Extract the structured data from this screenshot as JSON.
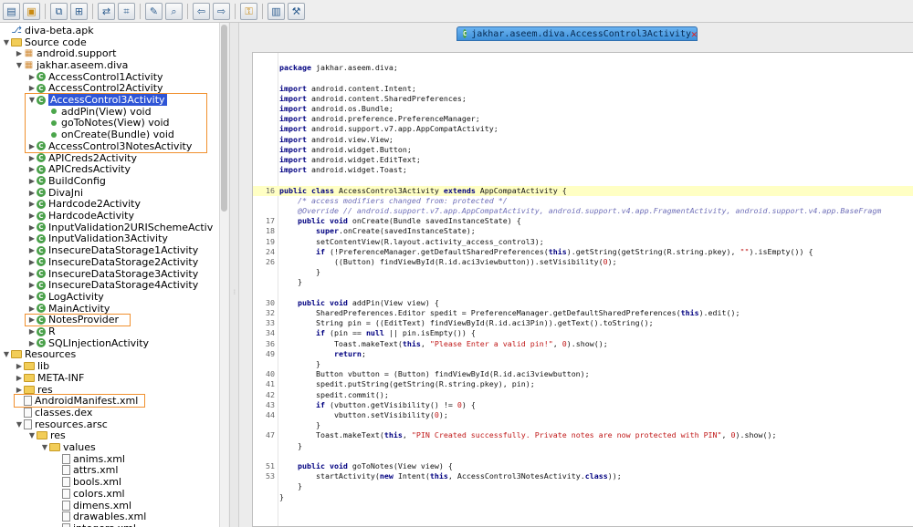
{
  "toolbar": {
    "buttons": [
      {
        "name": "open-file-icon",
        "glyph": "▤"
      },
      {
        "name": "add-files-icon",
        "glyph": "▣"
      },
      {
        "sep": true
      },
      {
        "name": "save-all-icon",
        "glyph": "⧉"
      },
      {
        "name": "export-icon",
        "glyph": "⊞"
      },
      {
        "sep": true
      },
      {
        "name": "sync-tree-icon",
        "glyph": "⇄"
      },
      {
        "name": "flatten-packages-icon",
        "glyph": "⌗"
      },
      {
        "sep": true
      },
      {
        "name": "search-text-icon",
        "glyph": "✎"
      },
      {
        "name": "search-class-icon",
        "glyph": "⌕"
      },
      {
        "sep": true
      },
      {
        "name": "back-icon",
        "glyph": "⇦"
      },
      {
        "name": "forward-icon",
        "glyph": "⇨"
      },
      {
        "sep": true
      },
      {
        "name": "deobfuscation-icon",
        "glyph": "⚿"
      },
      {
        "sep": true
      },
      {
        "name": "log-viewer-icon",
        "glyph": "▥"
      },
      {
        "name": "preferences-icon",
        "glyph": "⚒"
      }
    ]
  },
  "tree": [
    {
      "indent": 0,
      "icon": "r",
      "toggle": "",
      "label": "diva-beta.apk"
    },
    {
      "indent": 0,
      "icon": "f",
      "toggle": "▼",
      "label": "Source code"
    },
    {
      "indent": 1,
      "icon": "p",
      "toggle": "▶",
      "label": "android.support"
    },
    {
      "indent": 1,
      "icon": "p",
      "toggle": "▼",
      "label": "jakhar.aseem.diva"
    },
    {
      "indent": 2,
      "icon": "c",
      "toggle": "▶",
      "label": "AccessControl1Activity"
    },
    {
      "indent": 2,
      "icon": "c",
      "toggle": "▶",
      "label": "AccessControl2Activity"
    },
    {
      "indent": 2,
      "icon": "c",
      "toggle": "▼",
      "label": "AccessControl3Activity",
      "selected": true
    },
    {
      "indent": 3,
      "icon": "m",
      "toggle": "",
      "label": "addPin(View) void"
    },
    {
      "indent": 3,
      "icon": "m",
      "toggle": "",
      "label": "goToNotes(View) void"
    },
    {
      "indent": 3,
      "icon": "m",
      "toggle": "",
      "label": "onCreate(Bundle) void"
    },
    {
      "indent": 2,
      "icon": "c",
      "toggle": "▶",
      "label": "AccessControl3NotesActivity"
    },
    {
      "indent": 2,
      "icon": "c",
      "toggle": "▶",
      "label": "APICreds2Activity"
    },
    {
      "indent": 2,
      "icon": "c",
      "toggle": "▶",
      "label": "APICredsActivity"
    },
    {
      "indent": 2,
      "icon": "c",
      "toggle": "▶",
      "label": "BuildConfig"
    },
    {
      "indent": 2,
      "icon": "c",
      "toggle": "▶",
      "label": "DivaJni"
    },
    {
      "indent": 2,
      "icon": "c",
      "toggle": "▶",
      "label": "Hardcode2Activity"
    },
    {
      "indent": 2,
      "icon": "c",
      "toggle": "▶",
      "label": "HardcodeActivity"
    },
    {
      "indent": 2,
      "icon": "c",
      "toggle": "▶",
      "label": "InputValidation2URISchemeActiv"
    },
    {
      "indent": 2,
      "icon": "c",
      "toggle": "▶",
      "label": "InputValidation3Activity"
    },
    {
      "indent": 2,
      "icon": "c",
      "toggle": "▶",
      "label": "InsecureDataStorage1Activity"
    },
    {
      "indent": 2,
      "icon": "c",
      "toggle": "▶",
      "label": "InsecureDataStorage2Activity"
    },
    {
      "indent": 2,
      "icon": "c",
      "toggle": "▶",
      "label": "InsecureDataStorage3Activity"
    },
    {
      "indent": 2,
      "icon": "c",
      "toggle": "▶",
      "label": "InsecureDataStorage4Activity"
    },
    {
      "indent": 2,
      "icon": "c",
      "toggle": "▶",
      "label": "LogActivity"
    },
    {
      "indent": 2,
      "icon": "c",
      "toggle": "▶",
      "label": "MainActivity"
    },
    {
      "indent": 2,
      "icon": "c",
      "toggle": "▶",
      "label": "NotesProvider"
    },
    {
      "indent": 2,
      "icon": "c",
      "toggle": "▶",
      "label": "R"
    },
    {
      "indent": 2,
      "icon": "c",
      "toggle": "▶",
      "label": "SQLInjectionActivity"
    },
    {
      "indent": 0,
      "icon": "f",
      "toggle": "▼",
      "label": "Resources"
    },
    {
      "indent": 1,
      "icon": "f",
      "toggle": "▶",
      "label": "lib"
    },
    {
      "indent": 1,
      "icon": "f",
      "toggle": "▶",
      "label": "META-INF"
    },
    {
      "indent": 1,
      "icon": "f",
      "toggle": "▶",
      "label": "res"
    },
    {
      "indent": 1,
      "icon": "d",
      "toggle": "",
      "label": "AndroidManifest.xml"
    },
    {
      "indent": 1,
      "icon": "d",
      "toggle": "",
      "label": "classes.dex"
    },
    {
      "indent": 1,
      "icon": "d",
      "toggle": "▼",
      "label": "resources.arsc"
    },
    {
      "indent": 2,
      "icon": "f",
      "toggle": "▼",
      "label": "res"
    },
    {
      "indent": 3,
      "icon": "f",
      "toggle": "▼",
      "label": "values"
    },
    {
      "indent": 4,
      "icon": "d",
      "toggle": "",
      "label": "anims.xml"
    },
    {
      "indent": 4,
      "icon": "d",
      "toggle": "",
      "label": "attrs.xml"
    },
    {
      "indent": 4,
      "icon": "d",
      "toggle": "",
      "label": "bools.xml"
    },
    {
      "indent": 4,
      "icon": "d",
      "toggle": "",
      "label": "colors.xml"
    },
    {
      "indent": 4,
      "icon": "d",
      "toggle": "",
      "label": "dimens.xml"
    },
    {
      "indent": 4,
      "icon": "d",
      "toggle": "",
      "label": "drawables.xml"
    },
    {
      "indent": 4,
      "icon": "d",
      "toggle": "",
      "label": "integers.xml"
    }
  ],
  "editor": {
    "tab_title": "jakhar.aseem.diva.AccessControl3Activity",
    "lines": [
      {
        "n": "",
        "t": ""
      },
      {
        "n": "",
        "t": "<k>package</k> jakhar.aseem.diva;"
      },
      {
        "n": "",
        "t": ""
      },
      {
        "n": "",
        "t": "<k>import</k> android.content.Intent;"
      },
      {
        "n": "",
        "t": "<k>import</k> android.content.SharedPreferences;"
      },
      {
        "n": "",
        "t": "<k>import</k> android.os.Bundle;"
      },
      {
        "n": "",
        "t": "<k>import</k> android.preference.PreferenceManager;"
      },
      {
        "n": "",
        "t": "<k>import</k> android.support.v7.app.AppCompatActivity;"
      },
      {
        "n": "",
        "t": "<k>import</k> android.view.View;"
      },
      {
        "n": "",
        "t": "<k>import</k> android.widget.Button;"
      },
      {
        "n": "",
        "t": "<k>import</k> android.widget.EditText;"
      },
      {
        "n": "",
        "t": "<k>import</k> android.widget.Toast;"
      },
      {
        "n": "",
        "t": ""
      },
      {
        "n": "16",
        "t": "<k>public class</k> AccessControl3Activity <k>extends</k> AppCompatActivity {",
        "cur": true
      },
      {
        "n": "",
        "t": "    <cm>/* access modifiers changed from: protected */</cm>"
      },
      {
        "n": "",
        "t": "    <cm>@Override // android.support.v7.app.AppCompatActivity, android.support.v4.app.FragmentActivity, android.support.v4.app.BaseFragm</cm>"
      },
      {
        "n": "17",
        "t": "    <k>public void</k> onCreate(Bundle savedInstanceState) {"
      },
      {
        "n": "18",
        "t": "        <k>super</k>.onCreate(savedInstanceState);"
      },
      {
        "n": "19",
        "t": "        setContentView(R.layout.activity_access_control3);"
      },
      {
        "n": "24",
        "t": "        <k>if</k> (!PreferenceManager.getDefaultSharedPreferences(<k>this</k>).getString(getString(R.string.pkey), <s>\"\"</s>).isEmpty()) {"
      },
      {
        "n": "26",
        "t": "            ((Button) findViewById(R.id.aci3viewbutton)).setVisibility(<s>0</s>);"
      },
      {
        "n": "",
        "t": "        }"
      },
      {
        "n": "",
        "t": "    }"
      },
      {
        "n": "",
        "t": ""
      },
      {
        "n": "30",
        "t": "    <k>public void</k> addPin(View view) {"
      },
      {
        "n": "32",
        "t": "        SharedPreferences.Editor spedit = PreferenceManager.getDefaultSharedPreferences(<k>this</k>).edit();"
      },
      {
        "n": "33",
        "t": "        String pin = ((EditText) findViewById(R.id.aci3Pin)).getText().toString();"
      },
      {
        "n": "34",
        "t": "        <k>if</k> (pin == <k>null</k> || pin.isEmpty()) {"
      },
      {
        "n": "36",
        "t": "            Toast.makeText(<k>this</k>, <s>\"Please Enter a valid pin!\"</s>, <s>0</s>).show();"
      },
      {
        "n": "49",
        "t": "            <k>return</k>;"
      },
      {
        "n": "",
        "t": "        }"
      },
      {
        "n": "40",
        "t": "        Button vbutton = (Button) findViewById(R.id.aci3viewbutton);"
      },
      {
        "n": "41",
        "t": "        spedit.putString(getString(R.string.pkey), pin);"
      },
      {
        "n": "42",
        "t": "        spedit.commit();"
      },
      {
        "n": "43",
        "t": "        <k>if</k> (vbutton.getVisibility() != <s>0</s>) {"
      },
      {
        "n": "44",
        "t": "            vbutton.setVisibility(<s>0</s>);"
      },
      {
        "n": "",
        "t": "        }"
      },
      {
        "n": "47",
        "t": "        Toast.makeText(<k>this</k>, <s>\"PIN Created successfully. Private notes are now protected with PIN\"</s>, <s>0</s>).show();"
      },
      {
        "n": "",
        "t": "    }"
      },
      {
        "n": "",
        "t": ""
      },
      {
        "n": "51",
        "t": "    <k>public void</k> goToNotes(View view) {"
      },
      {
        "n": "53",
        "t": "        startActivity(<k>new</k> Intent(<k>this</k>, AccessControl3NotesActivity.<k>class</k>));"
      },
      {
        "n": "",
        "t": "    }"
      },
      {
        "n": "",
        "t": "}"
      }
    ]
  }
}
